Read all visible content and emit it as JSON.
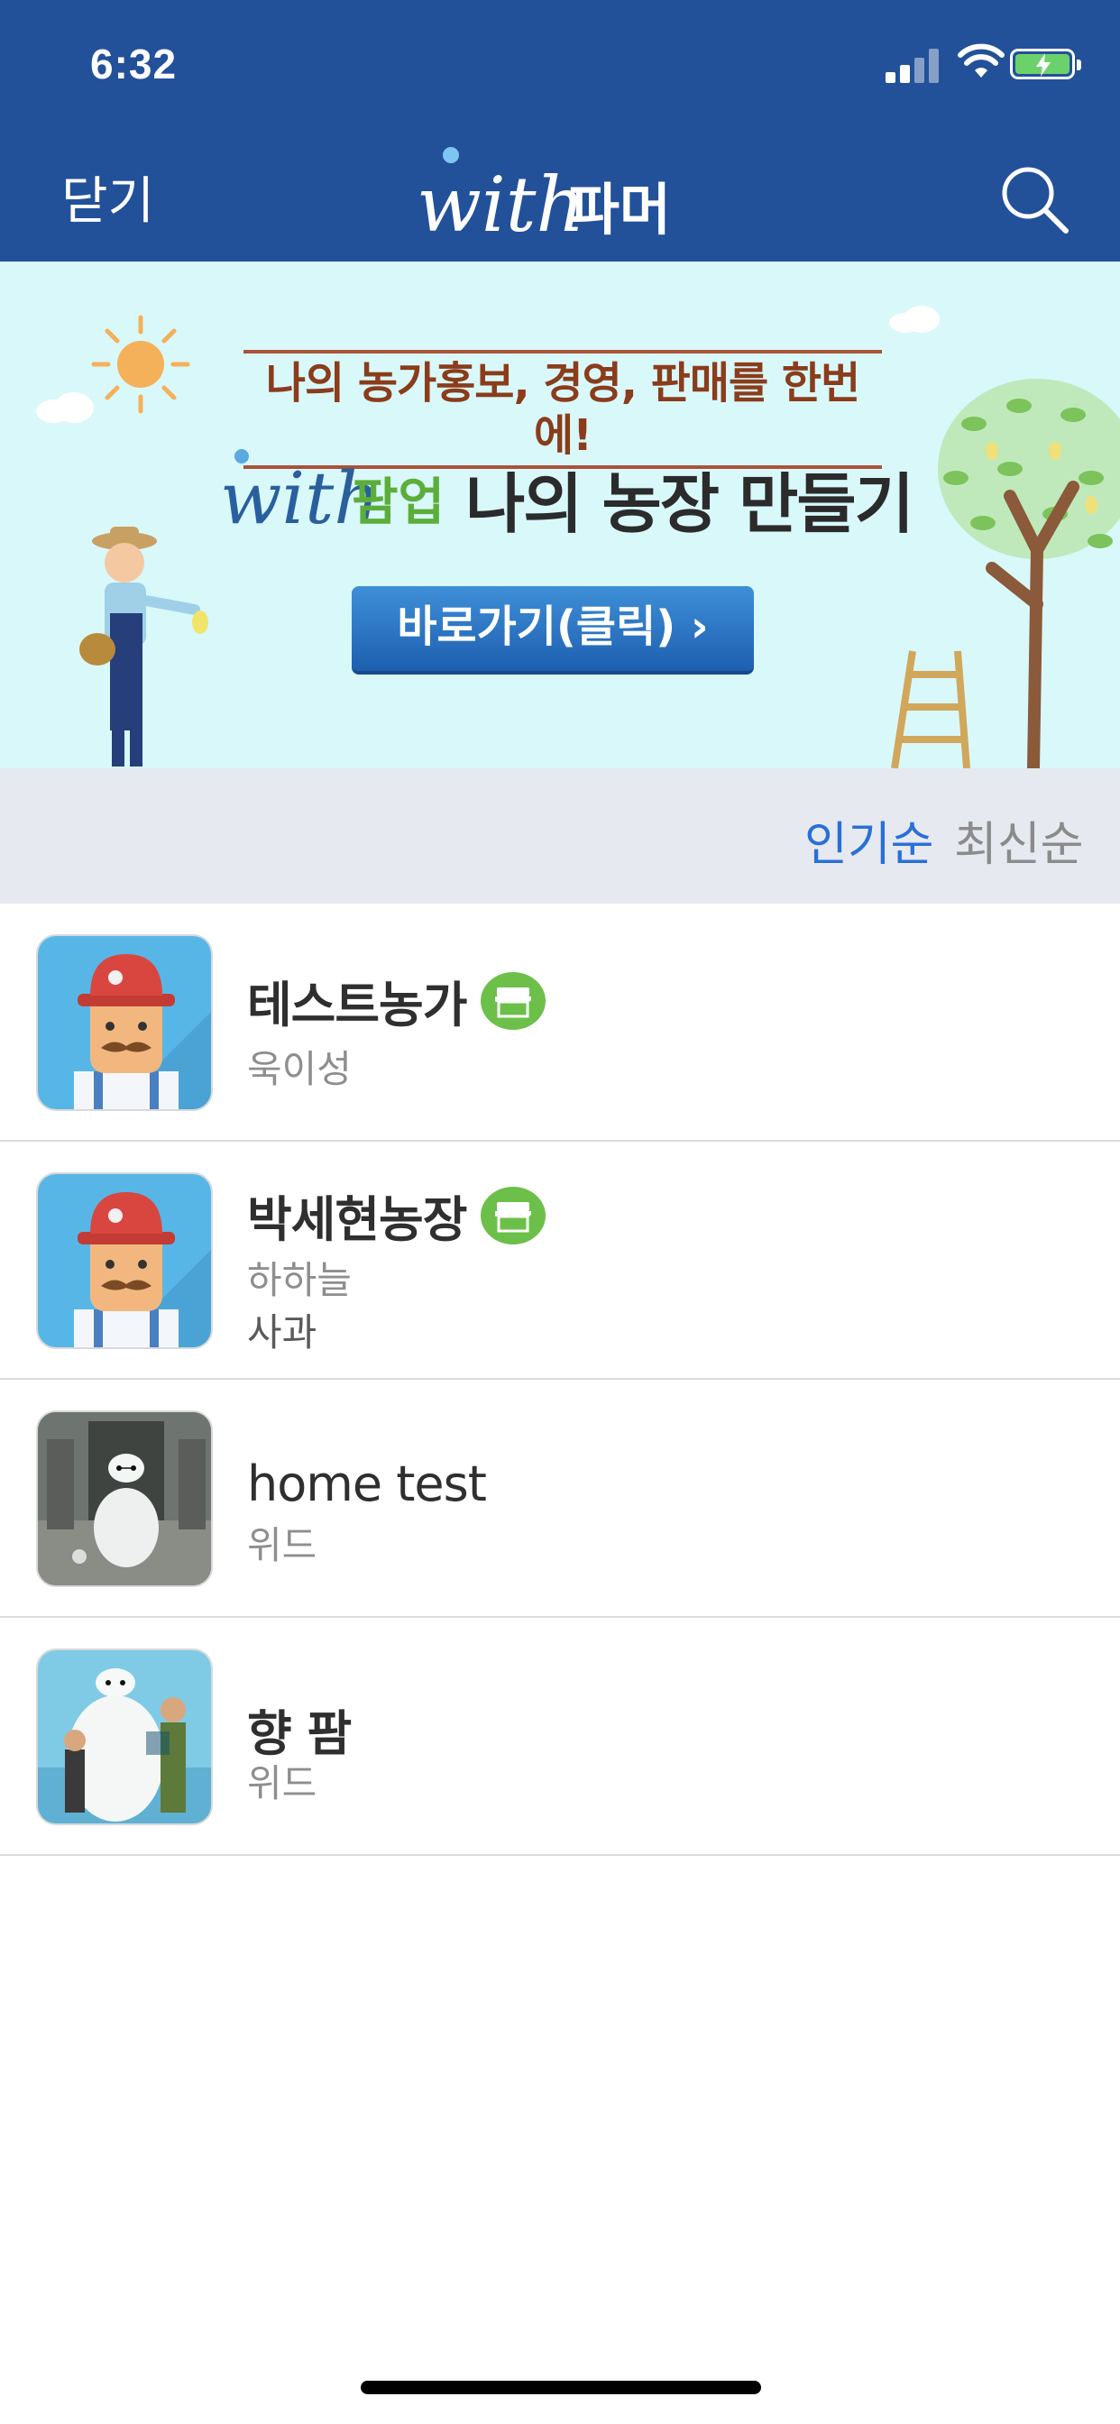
{
  "status_bar": {
    "time": "6:32"
  },
  "header": {
    "close_label": "닫기",
    "logo_text_latin": "with",
    "logo_text_korean": "파머",
    "bg_color": "#22519a"
  },
  "banner": {
    "headline": "나의 농가홍보, 경영, 판매를 한번에!",
    "brand_latin": "with",
    "brand_korean": "팜업",
    "title": "나의 농장 만들기",
    "button_label": "바로가기(클릭) ›"
  },
  "sort": {
    "popular_label": "인기순",
    "recent_label": "최신순",
    "active": "popular",
    "active_color": "#2a6fd6"
  },
  "farms": [
    {
      "name": "테스트농가",
      "owner": "욱이성",
      "crop": "",
      "has_shop_badge": true,
      "thumb": "farmer-avatar"
    },
    {
      "name": "박세현농장",
      "owner": "하하늘",
      "crop": "사과",
      "has_shop_badge": true,
      "thumb": "farmer-avatar"
    },
    {
      "name": "home test",
      "owner": "위드",
      "crop": "",
      "has_shop_badge": false,
      "thumb": "robot-hallway-photo"
    },
    {
      "name": "향 팜",
      "owner": "위드",
      "crop": "",
      "has_shop_badge": false,
      "thumb": "movie-poster-photo"
    }
  ]
}
